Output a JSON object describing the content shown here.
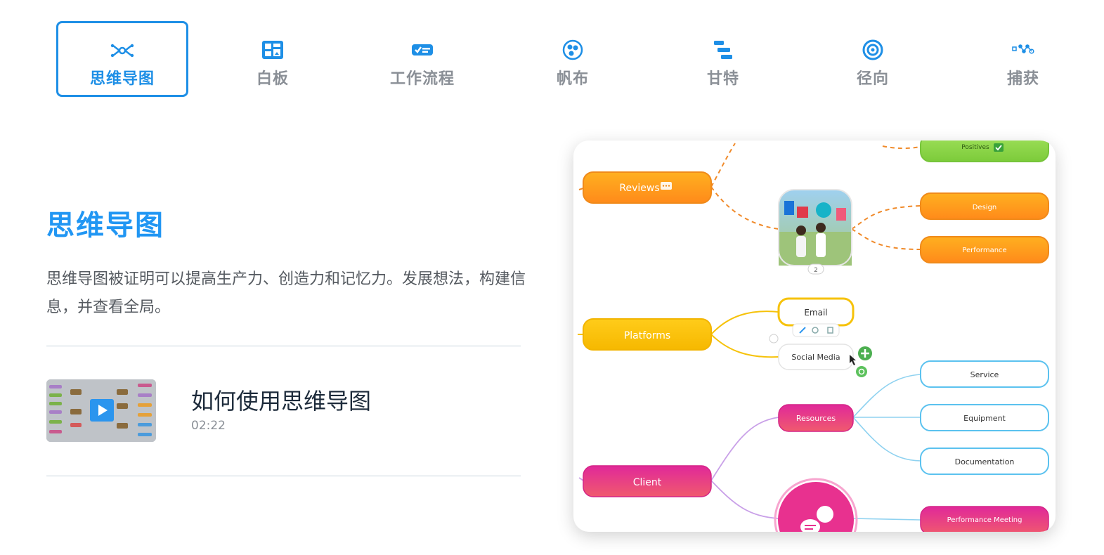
{
  "tabs": [
    {
      "label": "思维导图",
      "icon": "mind-map-icon",
      "active": true
    },
    {
      "label": "白板",
      "icon": "whiteboard-icon",
      "active": false
    },
    {
      "label": "工作流程",
      "icon": "workflow-icon",
      "active": false
    },
    {
      "label": "帆布",
      "icon": "canvas-icon",
      "active": false
    },
    {
      "label": "甘特",
      "icon": "gantt-icon",
      "active": false
    },
    {
      "label": "径向",
      "icon": "radial-icon",
      "active": false
    },
    {
      "label": "捕获",
      "icon": "capture-icon",
      "active": false
    }
  ],
  "content": {
    "title": "思维导图",
    "description": "思维导图被证明可以提高生产力、创造力和记忆力。发展想法，构建信息，并查看全局。",
    "video": {
      "title": "如何使用思维导图",
      "duration": "02:22"
    }
  },
  "mindmap": {
    "nodes": {
      "reviews": "Reviews",
      "platforms": "Platforms",
      "client": "Client",
      "positives": "Positives",
      "design": "Design",
      "performance": "Performance",
      "email": "Email",
      "social_media": "Social Media",
      "resources": "Resources",
      "service": "Service",
      "equipment": "Equipment",
      "documentation": "Documentation",
      "performance_meeting": "Performance Meeting"
    },
    "attachment_count": "2"
  },
  "colors": {
    "accent": "#1e8fe6",
    "tab_inactive": "#8a8f96",
    "orange_node": "#ff9a1f",
    "yellow_node": "#fbc10a",
    "pink_node": "#e8318f",
    "green_node": "#8fd94a",
    "blue_outline": "#5bc2ef"
  }
}
